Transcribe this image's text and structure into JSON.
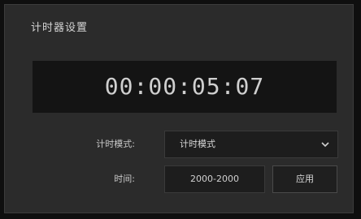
{
  "panel": {
    "title": "计时器设置"
  },
  "timer": {
    "display": "00:00:05:07"
  },
  "mode": {
    "label": "计时模式:",
    "selected": "计时模式"
  },
  "time": {
    "label": "时间:",
    "value": "2000-2000",
    "apply_label": "应用"
  },
  "icons": {
    "dropdown": "chevron-down-icon"
  }
}
